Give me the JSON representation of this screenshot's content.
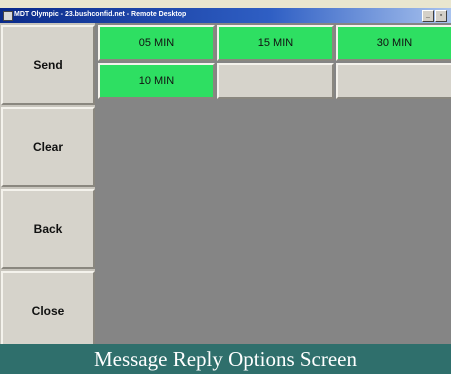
{
  "window": {
    "title": "MDT Olympic - 23.bushconfid.net - Remote Desktop",
    "min_glyph": "_",
    "max_glyph": "▫"
  },
  "sidebar": {
    "buttons": [
      {
        "label": "Send"
      },
      {
        "label": "Clear"
      },
      {
        "label": "Back"
      },
      {
        "label": "Close"
      }
    ]
  },
  "replies": [
    {
      "label": "05 MIN"
    },
    {
      "label": "15 MIN"
    },
    {
      "label": "30 MIN"
    },
    {
      "label": "10 MIN"
    }
  ],
  "caption": "Message Reply Options Screen",
  "colors": {
    "option_green": "#2edf62",
    "caption_bg": "#2f6f6c",
    "workspace_gray": "#858585"
  }
}
